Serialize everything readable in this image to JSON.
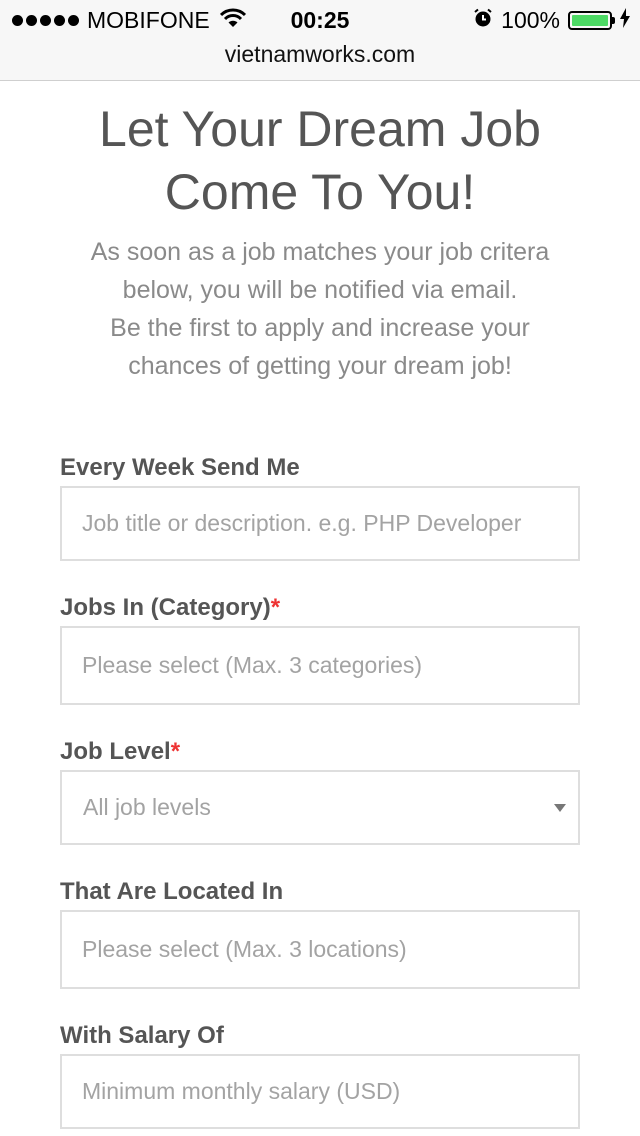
{
  "status_bar": {
    "carrier": "MOBIFONE",
    "time": "00:25",
    "battery": "100%",
    "icons": [
      "signal-dots-icon",
      "wifi-icon",
      "alarm-icon",
      "battery-icon",
      "charging-icon"
    ]
  },
  "browser": {
    "url": "vietnamworks.com"
  },
  "hero": {
    "title_line1": "Let Your Dream Job",
    "title_line2": "Come To You!",
    "text_line1": "As soon as a job matches your job critera",
    "text_line2": "below, you will be notified via email.",
    "text_line3": "Be the first to apply and increase your",
    "text_line4": "chances of getting your dream job!"
  },
  "form": {
    "keyword": {
      "label": "Every Week Send Me",
      "placeholder": "Job title or description. e.g. PHP Developer"
    },
    "category": {
      "label": "Jobs In (Category)",
      "required_mark": "*",
      "placeholder": "Please select (Max. 3 categories)"
    },
    "level": {
      "label": "Job Level",
      "required_mark": "*",
      "selected": "All job levels"
    },
    "location": {
      "label": "That Are Located In",
      "placeholder": "Please select (Max. 3 locations)"
    },
    "salary": {
      "label": "With Salary Of",
      "placeholder": "Minimum monthly salary (USD)"
    }
  },
  "colors": {
    "required": "#ee3333",
    "battery": "#4cd964",
    "border": "#dedede"
  }
}
